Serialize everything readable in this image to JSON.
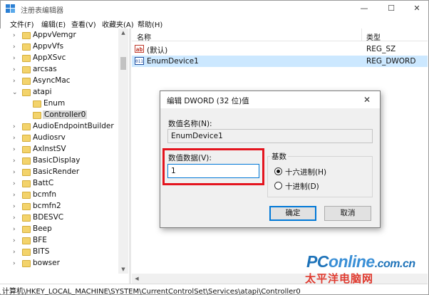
{
  "window": {
    "title": "注册表编辑器",
    "controls": {
      "minimize": "—",
      "maximize": "☐",
      "close": "✕"
    }
  },
  "menu": [
    "文件(F)",
    "编辑(E)",
    "查看(V)",
    "收藏夹(A)",
    "帮助(H)"
  ],
  "tree": {
    "items": [
      {
        "label": "AppvVemgr",
        "expander": "›"
      },
      {
        "label": "AppvVfs",
        "expander": "›"
      },
      {
        "label": "AppXSvc",
        "expander": "›"
      },
      {
        "label": "arcsas",
        "expander": "›"
      },
      {
        "label": "AsyncMac",
        "expander": "›"
      },
      {
        "label": "atapi",
        "expander": "⌄"
      },
      {
        "label": "Enum",
        "expander": ""
      },
      {
        "label": "Controller0",
        "expander": ""
      },
      {
        "label": "AudioEndpointBuilder",
        "expander": "›"
      },
      {
        "label": "Audiosrv",
        "expander": "›"
      },
      {
        "label": "AxInstSV",
        "expander": "›"
      },
      {
        "label": "BasicDisplay",
        "expander": "›"
      },
      {
        "label": "BasicRender",
        "expander": "›"
      },
      {
        "label": "BattC",
        "expander": "›"
      },
      {
        "label": "bcmfn",
        "expander": "›"
      },
      {
        "label": "bcmfn2",
        "expander": "›"
      },
      {
        "label": "BDESVC",
        "expander": "›"
      },
      {
        "label": "Beep",
        "expander": "›"
      },
      {
        "label": "BFE",
        "expander": "›"
      },
      {
        "label": "BITS",
        "expander": "›"
      },
      {
        "label": "bowser",
        "expander": "›"
      }
    ],
    "selected": "Controller0"
  },
  "values_list": {
    "columns": {
      "name": "名称",
      "type": "类型"
    },
    "rows": [
      {
        "icon": "ab",
        "name": "(默认)",
        "type": "REG_SZ"
      },
      {
        "icon": "011",
        "name": "EnumDevice1",
        "type": "REG_DWORD"
      }
    ]
  },
  "status_bar": "计算机\\HKEY_LOCAL_MACHINE\\SYSTEM\\CurrentControlSet\\Services\\atapi\\Controller0",
  "dialog": {
    "title": "编辑 DWORD (32 位)值",
    "close": "✕",
    "value_name_label": "数值名称(N):",
    "value_name": "EnumDevice1",
    "value_data_label": "数值数据(V):",
    "value_data": "1",
    "base_label": "基数",
    "base_options": [
      "十六进制(H)",
      "十进制(D)"
    ],
    "base_selected": "十六进制(H)",
    "ok": "确定",
    "cancel": "取消"
  },
  "watermark": {
    "logo_p": "PC",
    "logo_online": "online",
    "logo_suffix": ".com.cn",
    "cn": "太平洋电脑网"
  },
  "colors": {
    "highlight": "#e4141e",
    "selection": "#cce8ff",
    "folder": "#f3d36b",
    "dialog_bg": "#f0f0f0"
  }
}
